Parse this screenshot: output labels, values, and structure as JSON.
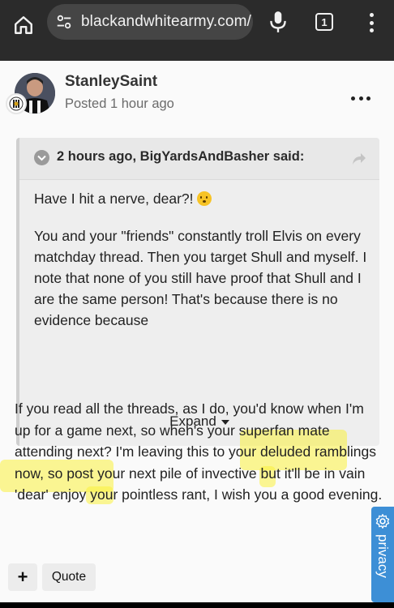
{
  "browser": {
    "url": "blackandwhitearmy.com/",
    "tab_count": "1"
  },
  "post": {
    "author": "StanleySaint",
    "posted": "Posted 1 hour ago"
  },
  "quote": {
    "attribution": "2 hours ago, BigYardsAndBasher said:",
    "paragraph_1": "Have I hit a nerve, dear?!",
    "paragraph_2": "You and your \"friends\" constantly troll Elvis on every matchday thread.  Then you target Shull and myself.  I note that none of you still have proof that Shull and I are the same person! That's because there is no evidence because",
    "expand_label": "Expand"
  },
  "reply": {
    "text": "If you read all the threads, as I do, you'd know when I'm up for a game next, so when's your superfan mate attending next? I'm leaving this to your deluded ramblings now, so post your next pile of invective but it'll be in vain 'dear' enjoy your pointless rant, I wish you a good evening."
  },
  "actions": {
    "plus_label": "+",
    "quote_label": "Quote"
  },
  "privacy": {
    "label": "privacy"
  },
  "colors": {
    "browser_bar": "#2b2b2b",
    "url_pill": "#454545",
    "privacy_tab": "#3d8fd6",
    "highlight": "#faf03c"
  }
}
